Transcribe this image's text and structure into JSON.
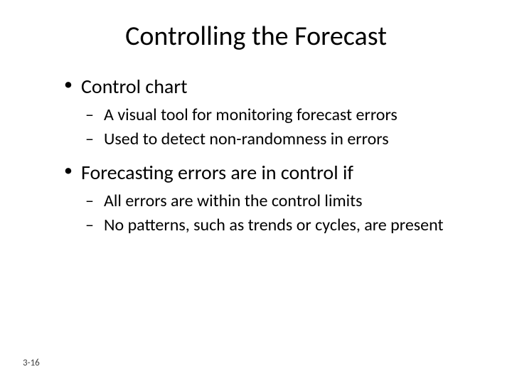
{
  "title": "Controlling the Forecast",
  "bullets": [
    {
      "label": "Control chart",
      "subitems": [
        "A visual tool for monitoring forecast errors",
        "Used to detect non-randomness in errors"
      ]
    },
    {
      "label": "Forecasting errors are in control if",
      "subitems": [
        "All errors are within the control limits",
        "No patterns, such as trends or cycles, are present"
      ]
    }
  ],
  "page_number": "3-16"
}
